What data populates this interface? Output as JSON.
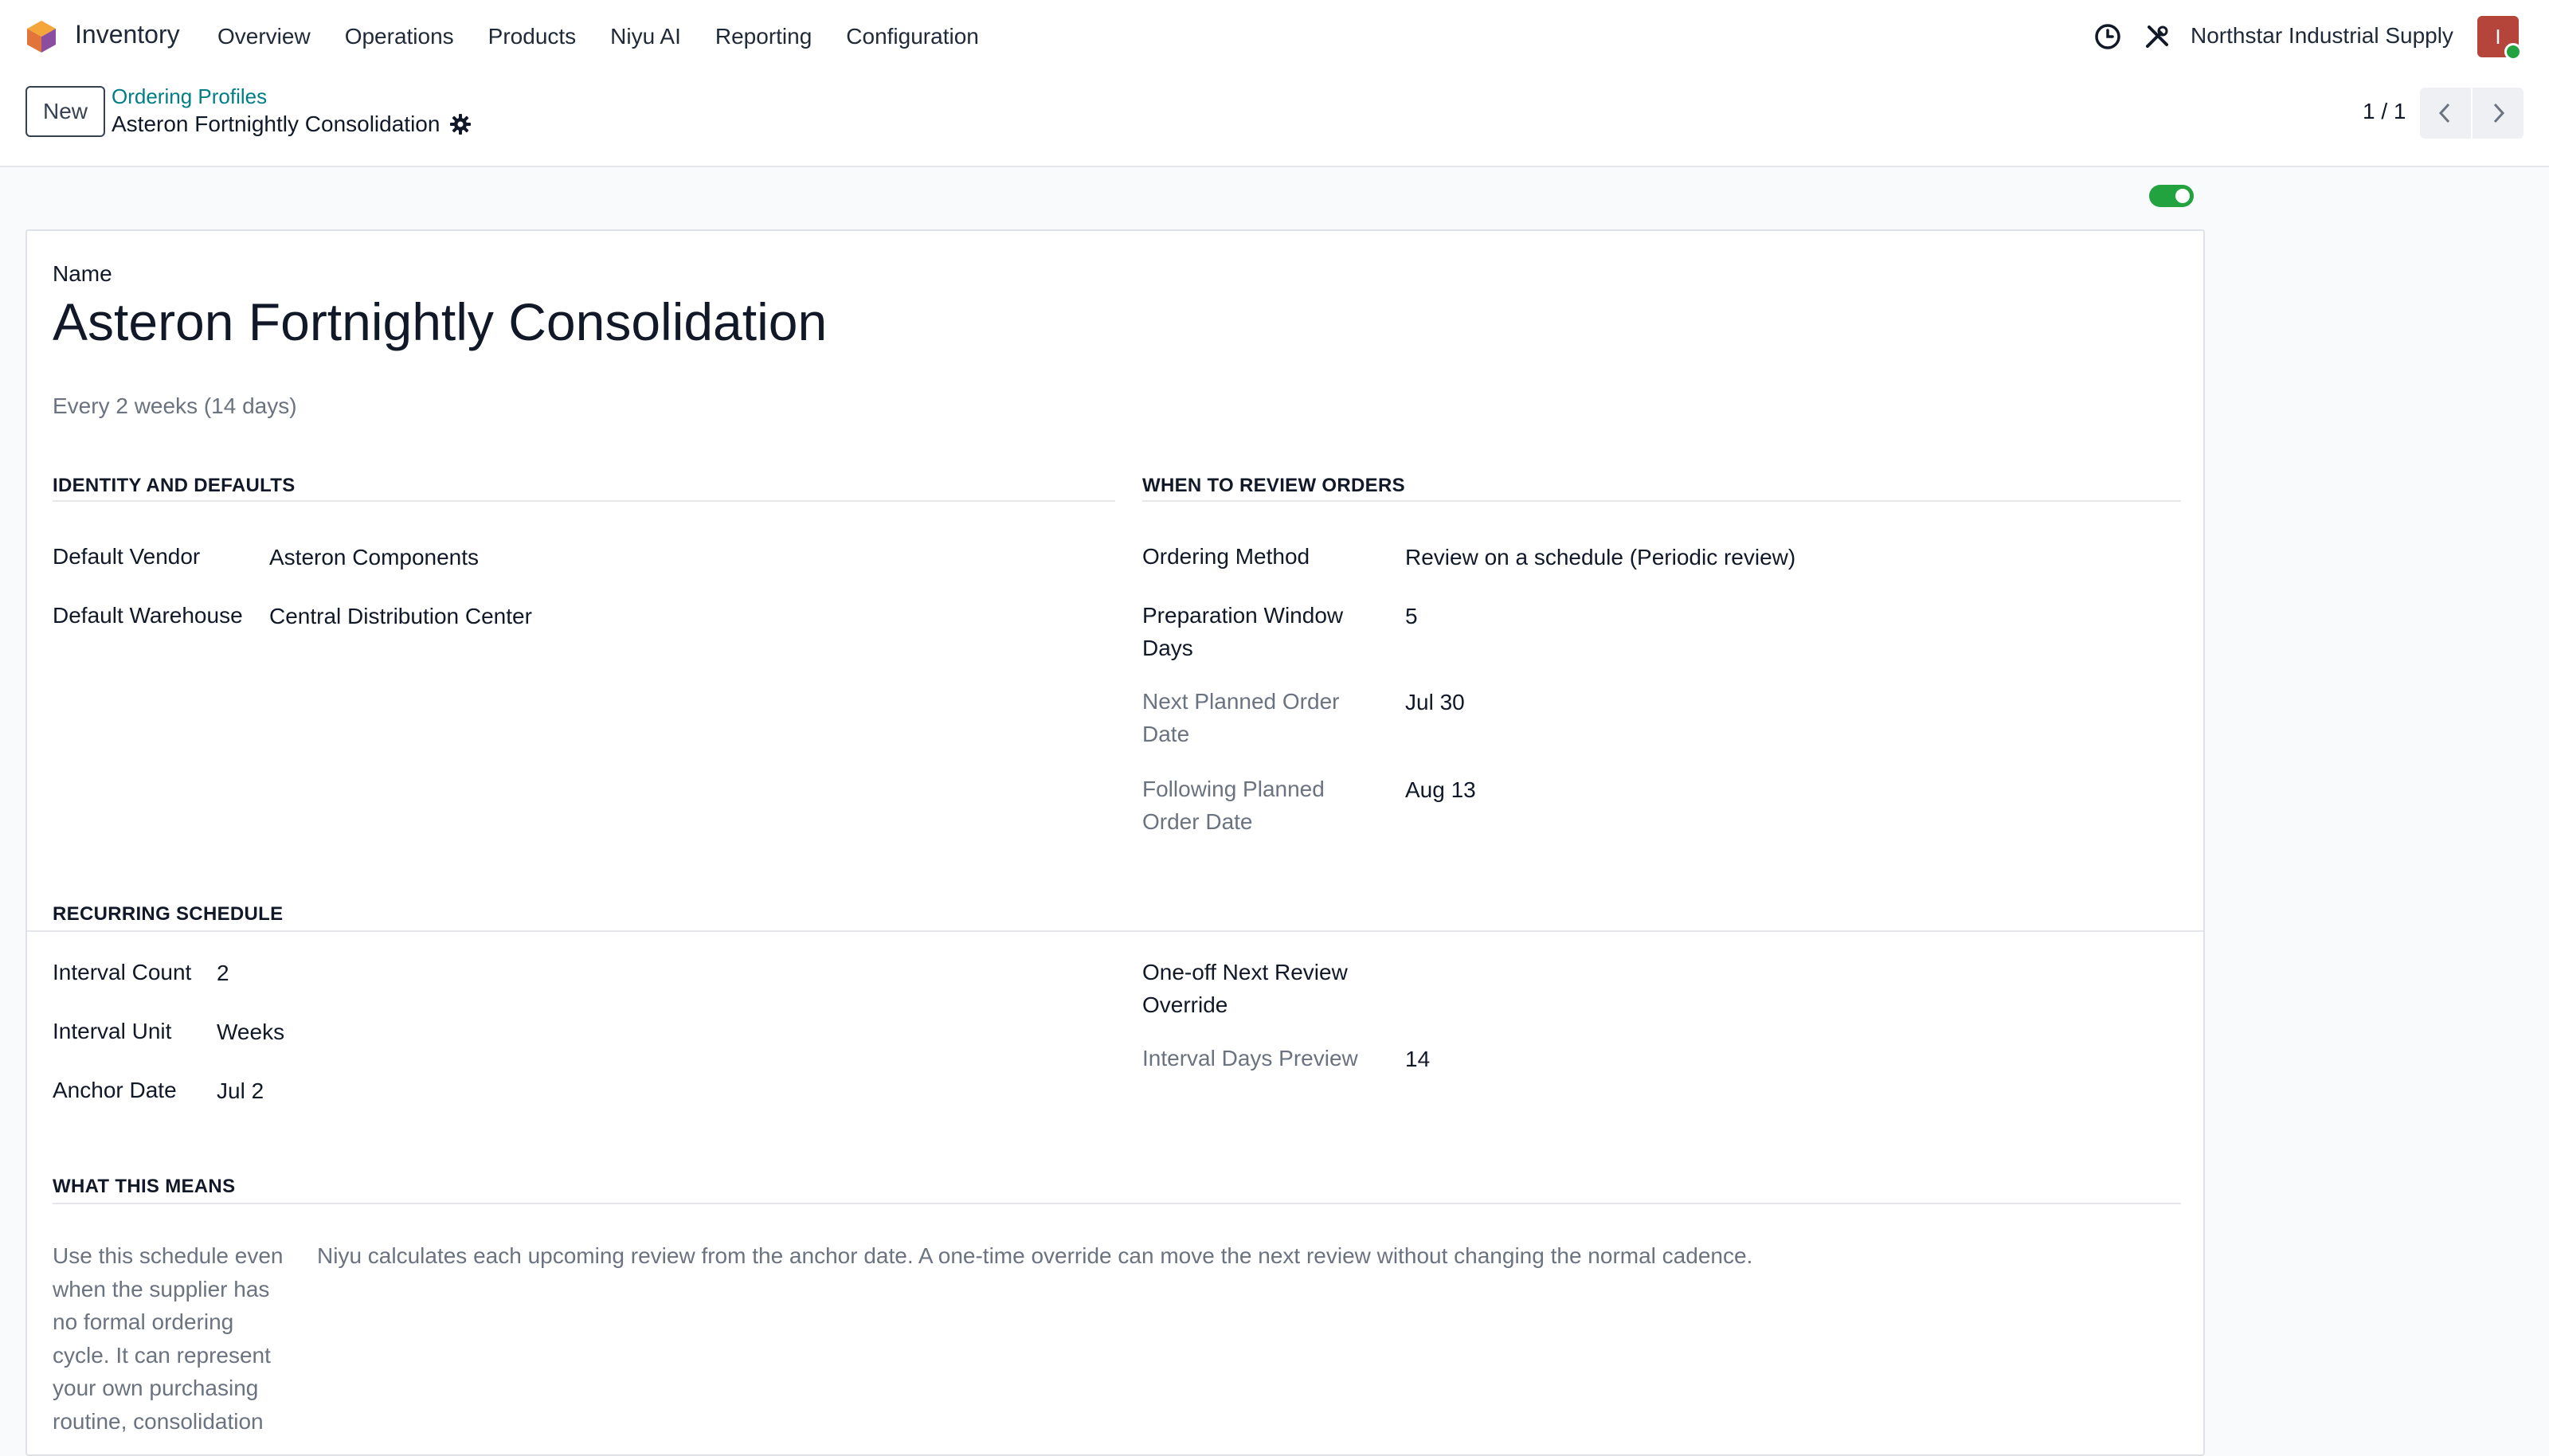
{
  "nav": {
    "app_name": "Inventory",
    "menu": [
      "Overview",
      "Operations",
      "Products",
      "Niyu AI",
      "Reporting",
      "Configuration"
    ],
    "company": "Northstar Industrial Supply",
    "avatar_initial": "I",
    "icons": {
      "logo": "app-logo-icon",
      "activity": "clock-icon",
      "tools": "tools-icon"
    }
  },
  "control": {
    "new_label": "New",
    "breadcrumb_parent": "Ordering Profiles",
    "breadcrumb_current": "Asteron Fortnightly Consolidation",
    "pager": "1 / 1"
  },
  "record": {
    "active": true,
    "name_label": "Name",
    "name": "Asteron Fortnightly Consolidation",
    "subtitle": "Every 2 weeks (14 days)"
  },
  "identity": {
    "title": "IDENTITY AND DEFAULTS",
    "default_vendor_label": "Default Vendor",
    "default_vendor": "Asteron Components",
    "default_warehouse_label": "Default Warehouse",
    "default_warehouse": "Central Distribution Center"
  },
  "review": {
    "title": "WHEN TO REVIEW ORDERS",
    "ordering_method_label": "Ordering Method",
    "ordering_method": "Review on a schedule (Periodic review)",
    "prep_window_label": "Preparation Window Days",
    "prep_window": "5",
    "next_planned_label": "Next Planned Order Date",
    "next_planned": "Jul 30",
    "following_planned_label": "Following Planned Order Date",
    "following_planned": "Aug 13"
  },
  "schedule": {
    "title": "RECURRING SCHEDULE",
    "interval_count_label": "Interval Count",
    "interval_count": "2",
    "interval_unit_label": "Interval Unit",
    "interval_unit": "Weeks",
    "anchor_date_label": "Anchor Date",
    "anchor_date": "Jul 2",
    "override_label": "One-off Next Review Override",
    "override": "",
    "interval_days_label": "Interval Days Preview",
    "interval_days": "14"
  },
  "means": {
    "title": "WHAT THIS MEANS",
    "left_text": "Use this schedule even when the supplier has no formal ordering cycle. It can represent your own purchasing routine, consolidation",
    "right_text": "Niyu calculates each upcoming review from the anchor date. A one-time override can move the next review without changing the normal cadence."
  },
  "colors": {
    "accent": "#017e84",
    "toggle_on": "#22a33f",
    "avatar": "#b5443a"
  }
}
